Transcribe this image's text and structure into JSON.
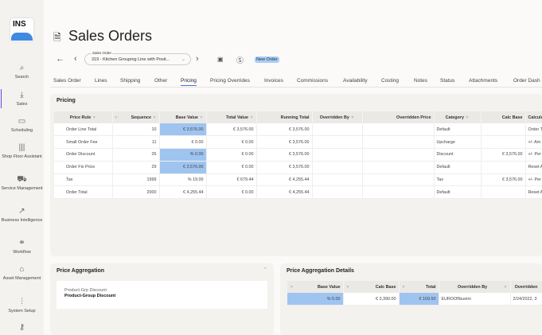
{
  "sidebar": {
    "logo": "INS",
    "items": [
      {
        "label": "Search",
        "icon": "search-icon"
      },
      {
        "label": "Sales",
        "icon": "sales-icon",
        "active": true
      },
      {
        "label": "Scheduling",
        "icon": "calendar-icon"
      },
      {
        "label": "Shop Floor Assistant",
        "icon": "barcode-icon"
      },
      {
        "label": "Service Management",
        "icon": "truck-icon"
      },
      {
        "label": "Business Intelligence",
        "icon": "chart-icon"
      },
      {
        "label": "Workflow",
        "icon": "workflow-icon"
      },
      {
        "label": "Asset Management",
        "icon": "bank-icon"
      },
      {
        "label": "System Setup",
        "icon": "sliders-icon"
      },
      {
        "label": "",
        "icon": "key-icon"
      }
    ]
  },
  "header": {
    "title": "Sales Orders",
    "order_label": "Sales Order",
    "order_value": "319 - Kitchen Grouping Line with Posit...",
    "badge": "New Order"
  },
  "tabs": [
    "Sales Order",
    "Lines",
    "Shipping",
    "Other",
    "Pricing",
    "Pricing Overrides",
    "Invoices",
    "Commissions",
    "Availability",
    "Costing",
    "Notes",
    "Status",
    "Attachments",
    "Order Dash"
  ],
  "active_tab": "Pricing",
  "pricing": {
    "title": "Pricing",
    "columns": [
      "Price Rule",
      "Sequence",
      "Base Value",
      "Total Value",
      "Running Total",
      "Overridden By",
      "Overridden Price",
      "Category",
      "Calc Base",
      "Calcula"
    ],
    "rows": [
      [
        "Order Line Total",
        "10",
        "€ 3,576.00",
        "€ 3,576.00",
        "€ 3,576.00",
        "",
        "",
        "Default",
        "",
        "Order T"
      ],
      [
        "Small Order Fee",
        "11",
        "€ 0.00",
        "€ 0.00",
        "€ 3,576.00",
        "",
        "",
        "Upcharge",
        "",
        "+/- Am"
      ],
      [
        "Order Discount",
        "26",
        "% 0.00",
        "€ 0.00",
        "€ 3,576.00",
        "",
        "",
        "Discount",
        "€ 3,576.00",
        "+/- Per"
      ],
      [
        "Order Fix Price",
        "29",
        "€ 3,576.00",
        "€ 0.00",
        "€ 3,576.00",
        "",
        "",
        "Default",
        "",
        "Reset A"
      ],
      [
        "Tax",
        "1999",
        "% 19.00",
        "€ 679.44",
        "€ 4,255.44",
        "",
        "",
        "Tax",
        "€ 3,576.00",
        "+/- Per"
      ],
      [
        "Order Total",
        "2000",
        "€ 4,255.44",
        "€ 0.00",
        "€ 4,255.44",
        "",
        "",
        "Default",
        "",
        "Reset A"
      ]
    ],
    "highlighted_base_rows": [
      0,
      2,
      3
    ]
  },
  "aggregation": {
    "title": "Price Aggregation",
    "item_label": "Product-Grp Discount",
    "item_value": "Product-Group Discount"
  },
  "details": {
    "title": "Price Aggregation Details",
    "columns": [
      "Base Value",
      "Calc Base",
      "Total",
      "Overridden By",
      "Overridden"
    ],
    "rows": [
      [
        "% 5.00",
        "€ 3,390.00",
        "€ 169.50",
        "EUROOf\\bueini",
        "2/24/2022, 3"
      ]
    ]
  }
}
